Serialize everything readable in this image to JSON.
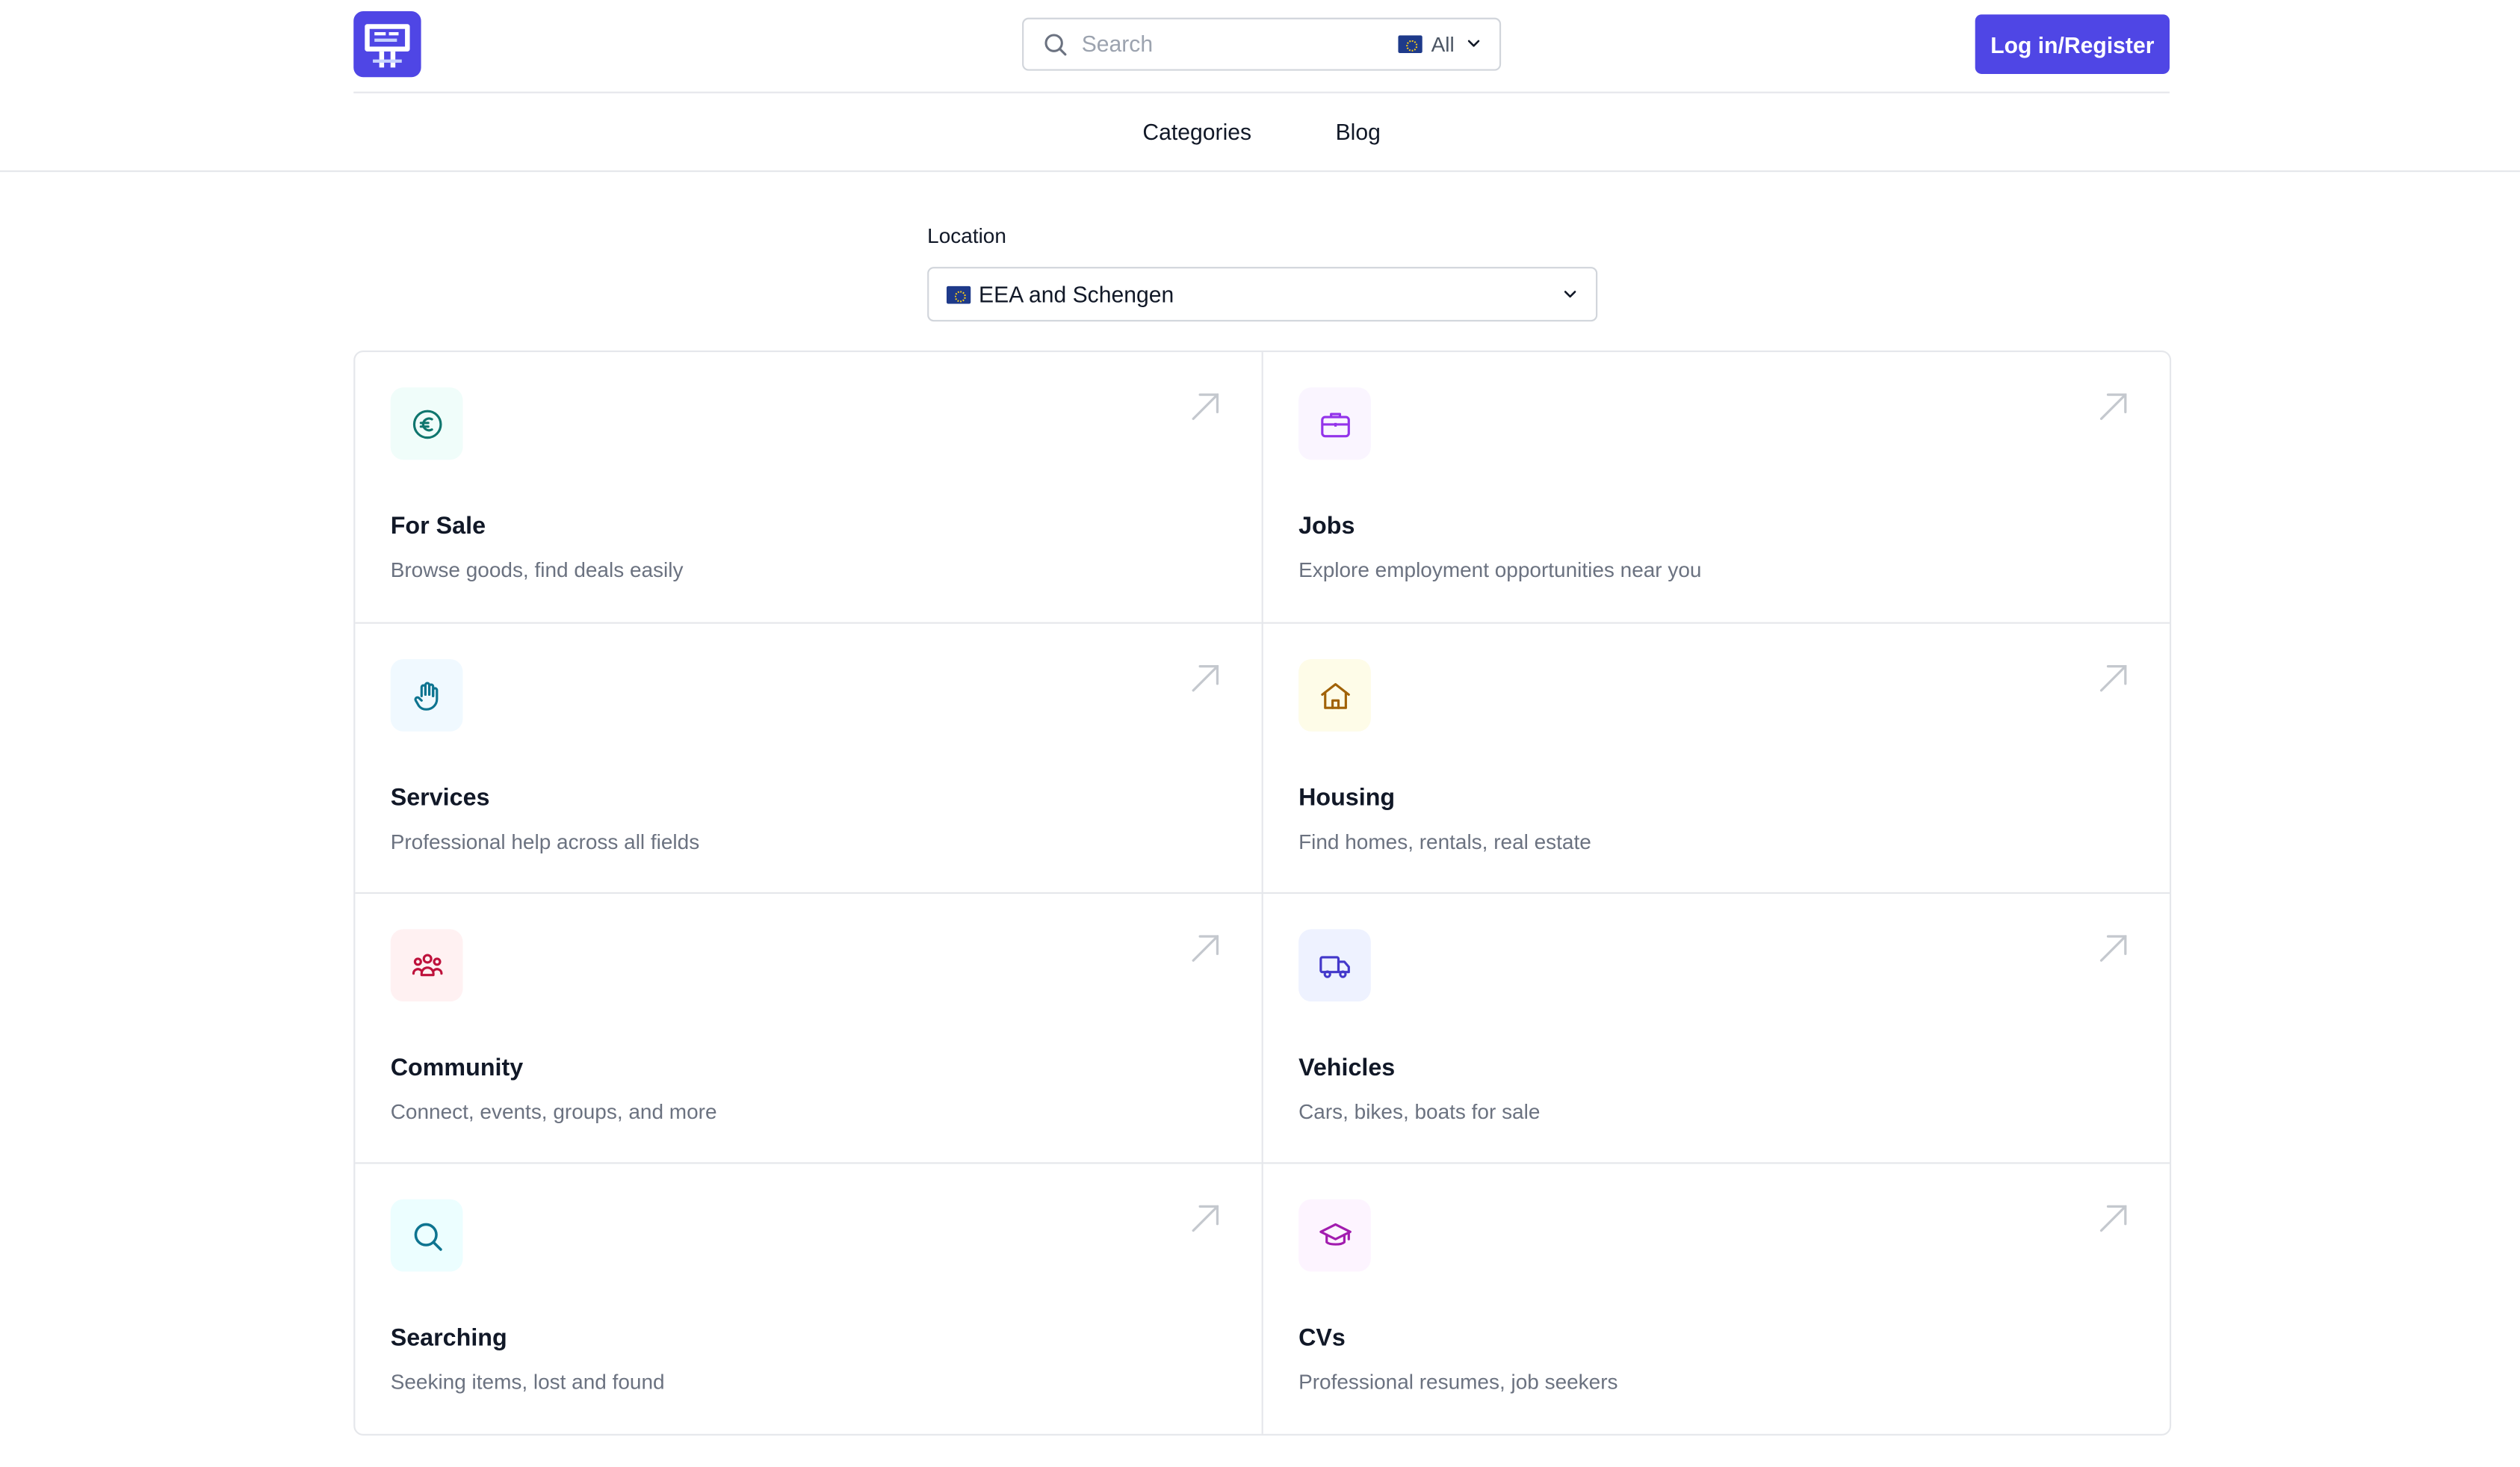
{
  "header": {
    "search_placeholder": "Search",
    "region_label": "All",
    "login_label": "Log in/Register"
  },
  "nav": {
    "categories": "Categories",
    "blog": "Blog"
  },
  "location": {
    "label": "Location",
    "value": "EEA and Schengen"
  },
  "colors": {
    "primary": "#4f46e5",
    "border": "#e5e7eb",
    "muted_text": "#6b7280"
  },
  "categories": [
    {
      "title": "For Sale",
      "desc": "Browse goods, find deals easily",
      "icon": "euro-icon",
      "icon_color": "#0f766e",
      "icon_bg": "#f0fdfa"
    },
    {
      "title": "Jobs",
      "desc": "Explore employment opportunities near you",
      "icon": "briefcase-icon",
      "icon_color": "#9333ea",
      "icon_bg": "#faf5ff"
    },
    {
      "title": "Services",
      "desc": "Professional help across all fields",
      "icon": "hand-icon",
      "icon_color": "#0e7490",
      "icon_bg": "#f0f9ff"
    },
    {
      "title": "Housing",
      "desc": "Find homes, rentals, real estate",
      "icon": "house-icon",
      "icon_color": "#a16207",
      "icon_bg": "#fefce8"
    },
    {
      "title": "Community",
      "desc": "Connect, events, groups, and more",
      "icon": "people-icon",
      "icon_color": "#be123c",
      "icon_bg": "#fff1f2"
    },
    {
      "title": "Vehicles",
      "desc": "Cars, bikes, boats for sale",
      "icon": "truck-icon",
      "icon_color": "#4338ca",
      "icon_bg": "#eef2ff"
    },
    {
      "title": "Searching",
      "desc": "Seeking items, lost and found",
      "icon": "magnifier-icon",
      "icon_color": "#0e7490",
      "icon_bg": "#ecfeff"
    },
    {
      "title": "CVs",
      "desc": "Professional resumes, job seekers",
      "icon": "graduation-cap-icon",
      "icon_color": "#a21caf",
      "icon_bg": "#fdf4ff"
    }
  ]
}
